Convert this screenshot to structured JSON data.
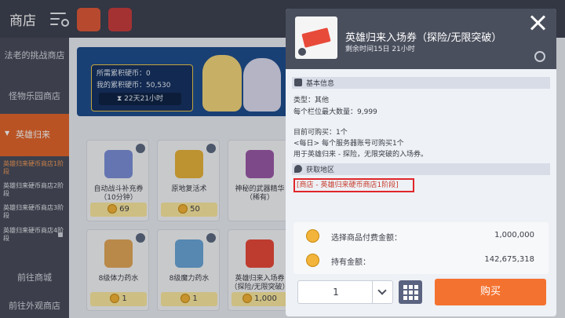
{
  "header": {
    "title": "商店"
  },
  "sidebar": {
    "items": [
      {
        "label": "法老的挑战商店"
      },
      {
        "label": "怪物乐园商店"
      },
      {
        "label": "英雄归来"
      }
    ],
    "subitems": [
      {
        "label": "英雄归来硬币商店1阶段"
      },
      {
        "label": "英雄归来硬币商店2阶段"
      },
      {
        "label": "英雄归来硬币商店3阶段"
      },
      {
        "label": "英雄归来硬币商店4阶段"
      }
    ],
    "bottom": [
      {
        "label": "前往商城"
      },
      {
        "label": "前往外观商店"
      }
    ]
  },
  "banner": {
    "need_label": "所需累积硬币：0",
    "have_label": "我的累积硬币：50,530",
    "timer": "22天21小时"
  },
  "shop": {
    "items": [
      {
        "name": "自动战斗补充券（10分钟）",
        "price": "69"
      },
      {
        "name": "原地复活术",
        "price": "50"
      },
      {
        "name": "神秘的武器精华（稀有）",
        "price": ""
      },
      {
        "name": "8级体力药水",
        "price": "1"
      },
      {
        "name": "8级魔力药水",
        "price": "1"
      },
      {
        "name": "英雄归来入场券（探险/无限突破）",
        "price": "1,000"
      }
    ]
  },
  "detail": {
    "name": "英雄归来入场券（探险/无限突破）",
    "remaining": "剩余时间15日 21小时",
    "basic_header": "基本信息",
    "type_line": "类型：其他",
    "stack_line": "每个栏位最大数量：9,999",
    "buyable_line": "目前可购买：1个",
    "daily_line": "<每日> 每个服务器账号可购买1个",
    "usage_line": "用于英雄归来 - 探险，无限突破的入场券。",
    "obtain_header": "获取地区",
    "location": "[商店 - 英雄归来硬币商店1阶段]",
    "pay_label": "选择商品付费金额：",
    "pay_value": "1,000,000",
    "hold_label": "持有金额：",
    "hold_value": "142,675,318",
    "quantity": "1",
    "buy_label": "购买"
  },
  "colors": {
    "accent": "#f47230",
    "sidebar_active": "#e2662c",
    "panel_header": "#4a4f5d",
    "highlight_border": "#e0262a"
  }
}
